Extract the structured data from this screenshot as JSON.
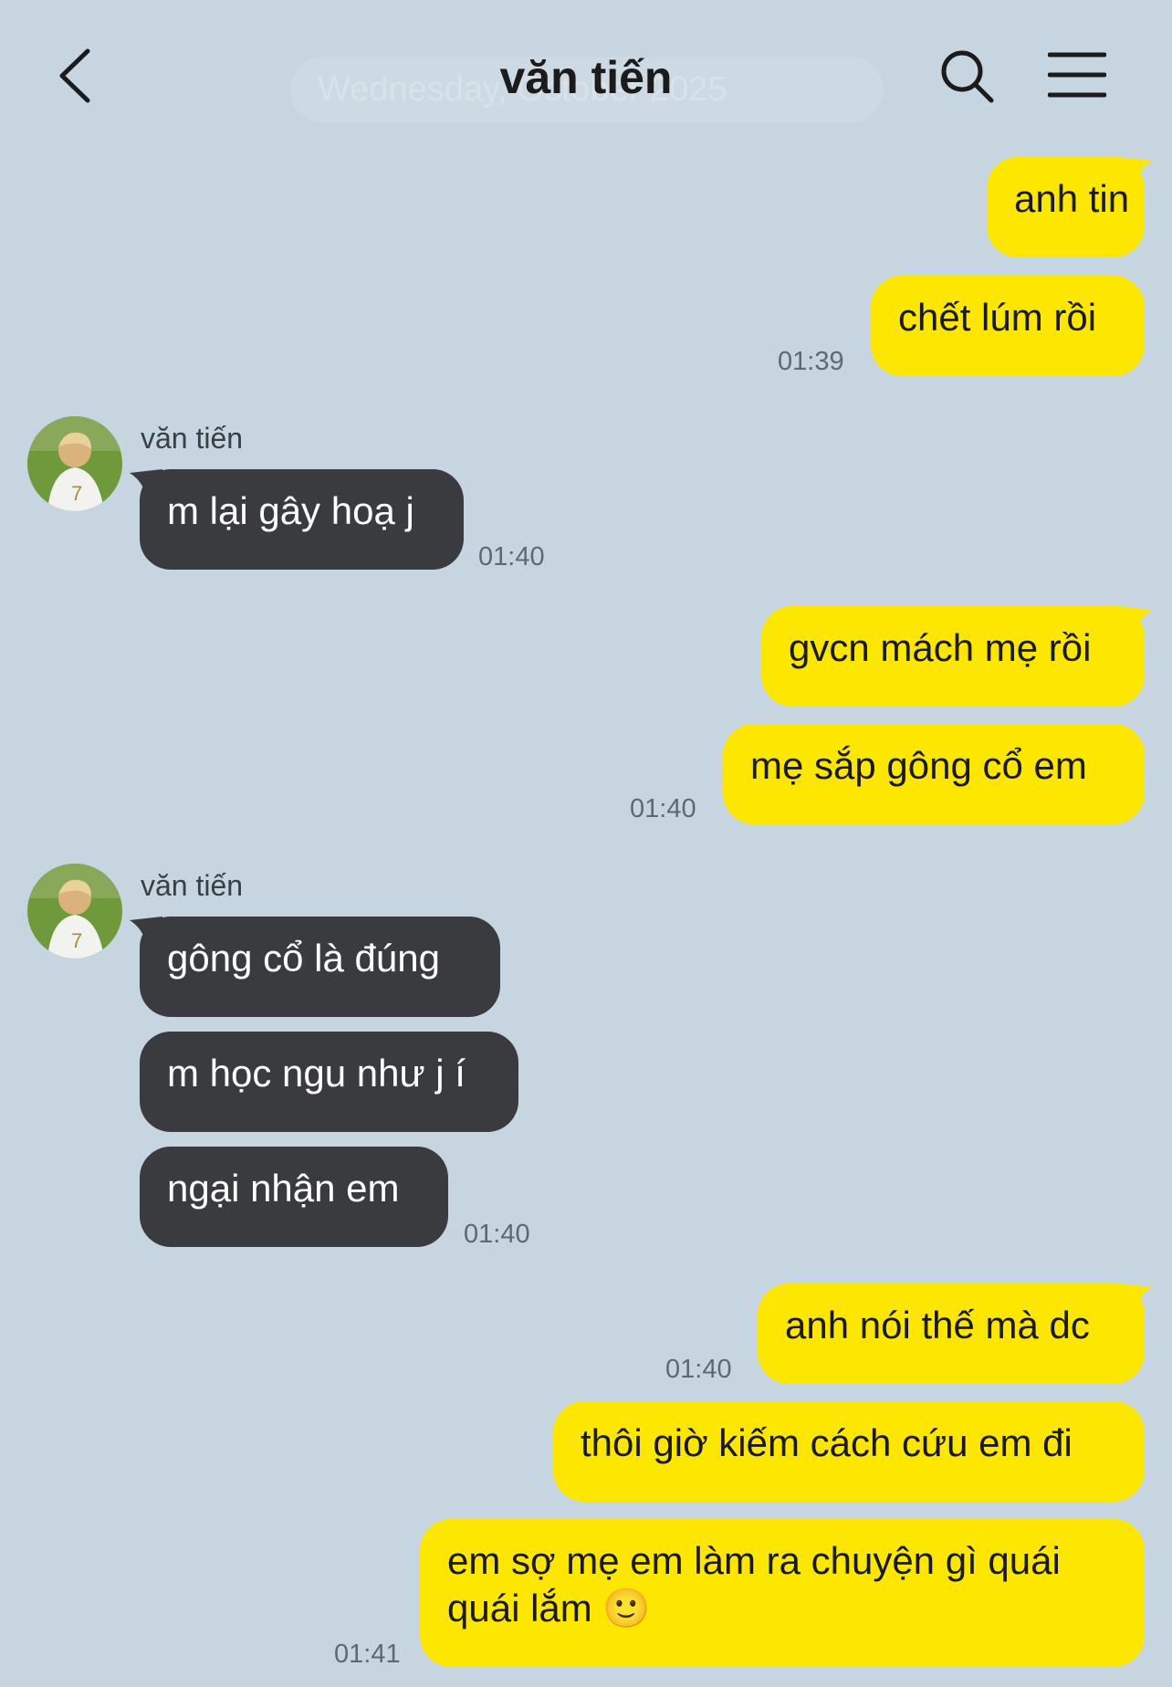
{
  "header": {
    "title": "văn tiến",
    "date_divider": "Wednesday, October 2025"
  },
  "colors": {
    "background": "#c6d5e0",
    "outgoing_bubble": "#fde700",
    "incoming_bubble": "#3a3b3f"
  },
  "messages": [
    {
      "text": "anh tin"
    },
    {
      "text": "chết lúm rồi",
      "time": "01:39"
    },
    {
      "sender": "văn tiến",
      "text": "m lại gây hoạ j",
      "time": "01:40"
    },
    {
      "text": "gvcn mách mẹ rồi"
    },
    {
      "text": "mẹ sắp gông cổ em",
      "time": "01:40"
    },
    {
      "sender": "văn tiến",
      "text": "gông cổ là đúng"
    },
    {
      "text": "m học ngu như j í"
    },
    {
      "text": "ngại nhận em",
      "time": "01:40"
    },
    {
      "text": "anh nói thế mà dc",
      "time": "01:40"
    },
    {
      "text": "thôi giờ kiếm cách cứu em đi"
    },
    {
      "line1": "em sợ mẹ em làm ra chuyện gì quái",
      "line2": "quái lắm 🙂",
      "time": "01:41"
    }
  ]
}
